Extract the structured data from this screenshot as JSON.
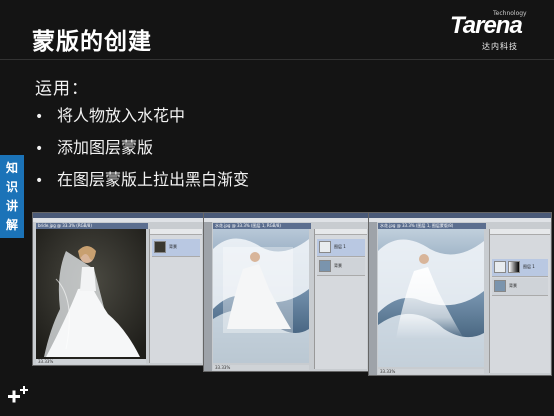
{
  "slide": {
    "title": "蒙版的创建",
    "subtitle": "运用：",
    "bullets": [
      "将人物放入水花中",
      "添加图层蒙版",
      "在图层蒙版上拉出黑白渐变"
    ],
    "side_tab": [
      "知",
      "识",
      "讲",
      "解"
    ]
  },
  "brand": {
    "name": "Tarena",
    "tagline": "Technology",
    "cn": "达内科技"
  },
  "colors": {
    "accent": "#1b73b8",
    "background": "#141414",
    "text": "#ffffff"
  },
  "screenshots": [
    {
      "doc_title": "bride.jpg @ 33.3% (RGB/8)",
      "status": "33.33%",
      "layers": [
        "背景",
        "背景"
      ]
    },
    {
      "doc_title": "水花.jpg @ 33.3% (图层 1, RGB/8)",
      "status": "33.33%",
      "layers": [
        "图层 1",
        "背景"
      ]
    },
    {
      "doc_title": "水花.jpg @ 33.3% (图层 1, 图层蒙版/8)",
      "status": "33.33%",
      "layers": [
        "图层 1",
        "背景"
      ]
    }
  ]
}
